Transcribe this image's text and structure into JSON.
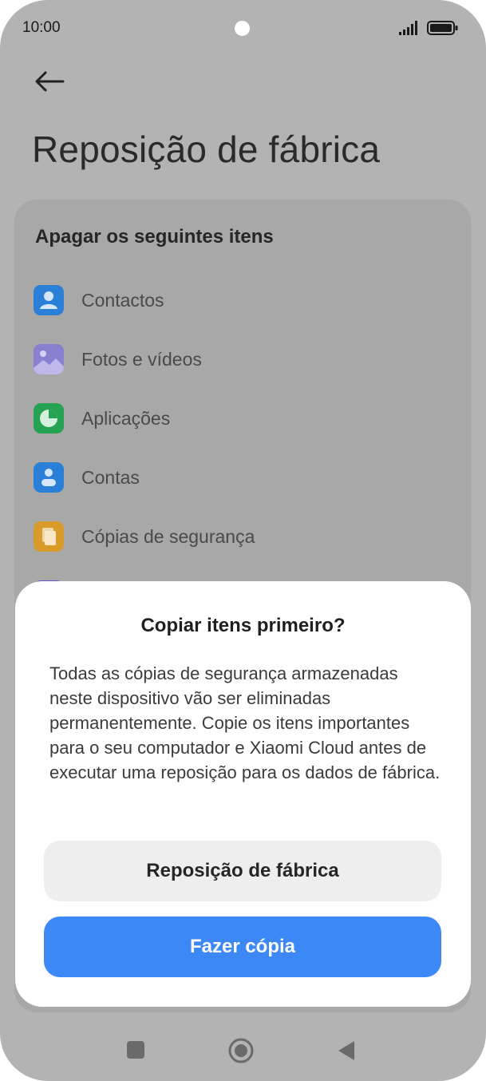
{
  "status_bar": {
    "time": "10:00"
  },
  "header": {
    "back_icon": "arrow-left-icon",
    "title": "Reposição de fábrica"
  },
  "section": {
    "title": "Apagar os seguintes itens",
    "items": [
      {
        "label": "Contactos",
        "icon": "contacts-icon",
        "color": "#2a7fd6"
      },
      {
        "label": "Fotos e vídeos",
        "icon": "gallery-icon",
        "color": "#7d72c8"
      },
      {
        "label": "Aplicações",
        "icon": "apps-pie-icon",
        "color": "#26a352"
      },
      {
        "label": "Contas",
        "icon": "account-icon",
        "color": "#2a7fd6"
      },
      {
        "label": "Cópias de segurança",
        "icon": "backup-icon",
        "color": "#d89a2a"
      }
    ]
  },
  "dialog": {
    "title": "Copiar itens primeiro?",
    "body": "Todas as cópias de segurança armazenadas neste dispositivo vão ser eliminadas permanentemente. Copie os itens importantes para o seu computador e Xiaomi Cloud antes de executar uma reposição para os dados de fábrica.",
    "reset_button": "Reposição de fábrica",
    "backup_button": "Fazer cópia"
  },
  "colors": {
    "primary": "#3d88f7",
    "overlay": "#b3b3b3"
  }
}
